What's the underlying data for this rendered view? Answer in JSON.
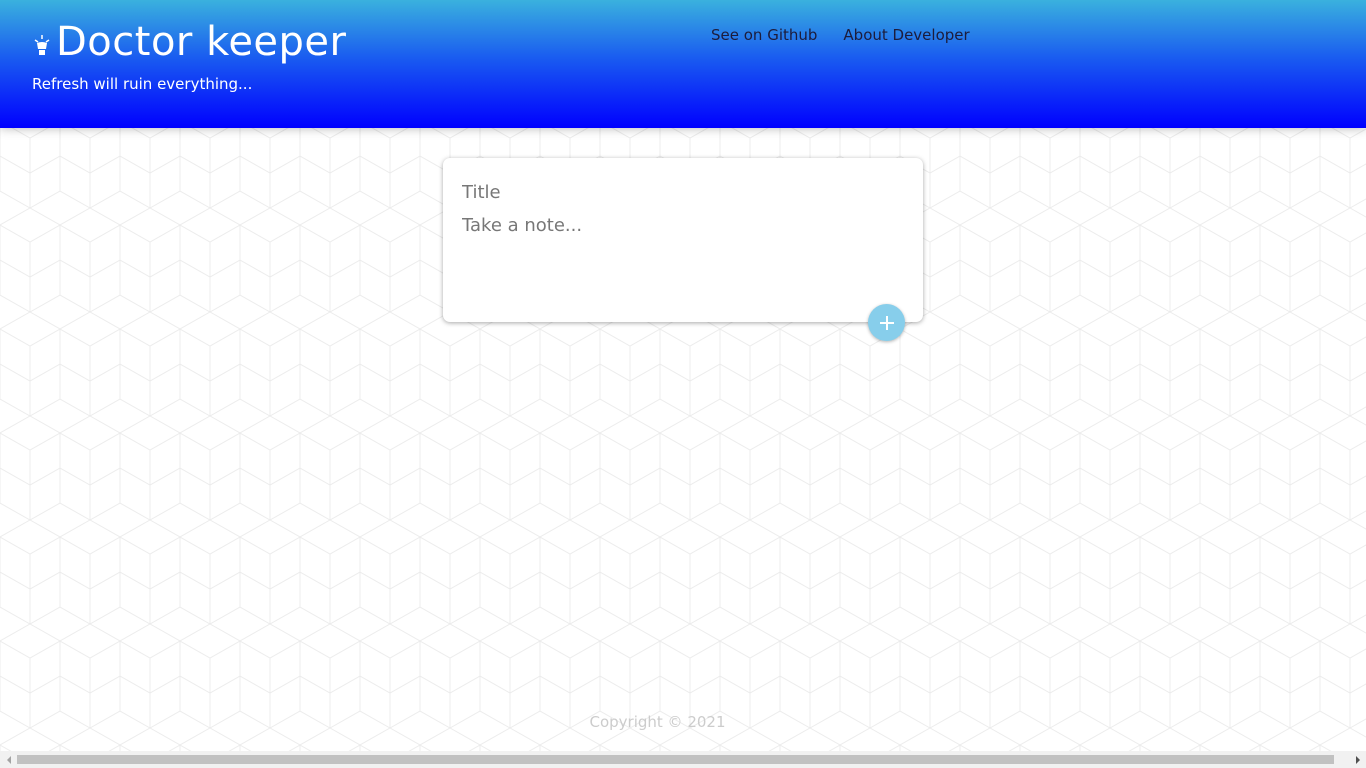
{
  "header": {
    "app_title": "Doctor keeper",
    "tagline": "Refresh will ruin everything...",
    "logo_icon": "lightbulb-icon",
    "nav": [
      {
        "label": "See on Github"
      },
      {
        "label": "About Developer"
      }
    ],
    "gradient_top": "#3ab1de",
    "gradient_bottom": "#0000ff"
  },
  "note_form": {
    "title_placeholder": "Title",
    "title_value": "",
    "body_placeholder": "Take a note...",
    "body_value": "",
    "add_icon": "plus-icon",
    "add_button_color": "#87ceeb"
  },
  "footer": {
    "copyright": "Copyright © 2021"
  }
}
